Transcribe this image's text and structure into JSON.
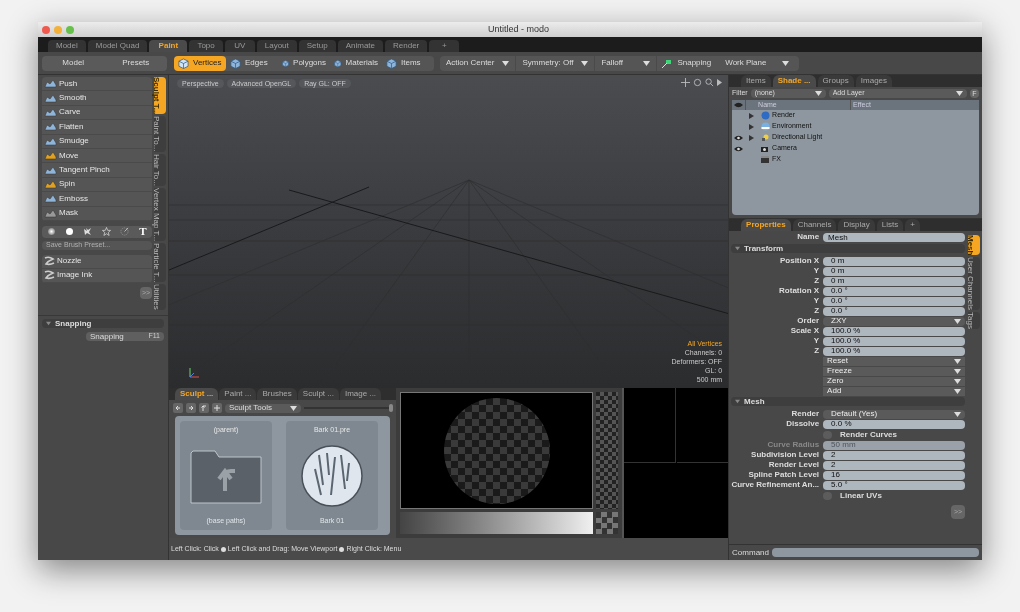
{
  "window": {
    "title": "Untitled - modo"
  },
  "layout_tabs": [
    {
      "label": "Model",
      "selected": false
    },
    {
      "label": "Model Quad",
      "selected": false
    },
    {
      "label": "Paint",
      "selected": true
    },
    {
      "label": "Topo",
      "selected": false
    },
    {
      "label": "UV",
      "selected": false
    },
    {
      "label": "Layout",
      "selected": false
    },
    {
      "label": "Setup",
      "selected": false
    },
    {
      "label": "Animate",
      "selected": false
    },
    {
      "label": "Render",
      "selected": false
    },
    {
      "label": "+",
      "selected": false
    }
  ],
  "toolbar": {
    "left_buttons": [
      "Model",
      "Presets"
    ],
    "selection_modes": [
      {
        "label": "Vertices",
        "selected": true
      },
      {
        "label": "Edges",
        "selected": false
      },
      {
        "label": "Polygons",
        "selected": false
      },
      {
        "label": "Materials",
        "selected": false
      },
      {
        "label": "Items",
        "selected": false
      }
    ],
    "dropdowns": [
      "Action Center",
      "Symmetry: Off",
      "Falloff"
    ],
    "snapping": "Snapping",
    "work_plane": "Work Plane"
  },
  "tools": [
    {
      "label": "Push"
    },
    {
      "label": "Smooth"
    },
    {
      "label": "Carve"
    },
    {
      "label": "Flatten"
    },
    {
      "label": "Smudge"
    },
    {
      "label": "Move"
    },
    {
      "label": "Tangent Pinch"
    },
    {
      "label": "Spin"
    },
    {
      "label": "Emboss"
    },
    {
      "label": "Mask"
    }
  ],
  "brush_shapes": [
    {
      "kind": "soft"
    },
    {
      "kind": "hard"
    },
    {
      "kind": "splat"
    },
    {
      "kind": "star"
    },
    {
      "kind": "angle"
    },
    {
      "kind": "text",
      "glyph": "T"
    }
  ],
  "save_preset_placeholder": "Save Brush Preset...",
  "inks": [
    {
      "label": "Nozzle"
    },
    {
      "label": "Image Ink"
    }
  ],
  "more_button": ">>",
  "side_tabs": [
    {
      "label": "Sculpt T...",
      "selected": true
    },
    {
      "label": "Paint To...",
      "selected": false
    },
    {
      "label": "Hair To...",
      "selected": false
    },
    {
      "label": "Vertex Map T...",
      "selected": false
    },
    {
      "label": "Particle T...",
      "selected": false
    },
    {
      "label": "Utilities",
      "selected": false
    }
  ],
  "snapping_section": {
    "title": "Snapping",
    "expanded": true,
    "item": "Snapping",
    "shortcut": "F11"
  },
  "viewport": {
    "buttons": [
      "Perspective",
      "Advanced OpenGL",
      "Ray GL: OFF"
    ],
    "info": [
      {
        "text": "All Vertices",
        "highlight": true
      },
      {
        "text": "Channels: 0",
        "highlight": false
      },
      {
        "text": "Deformers: OFF",
        "highlight": false
      },
      {
        "text": "GL: 0",
        "highlight": false
      },
      {
        "text": "500 mm",
        "highlight": false
      }
    ]
  },
  "preset_browser": {
    "tabs": [
      {
        "label": "Sculpt ...",
        "selected": true
      },
      {
        "label": "Paint ...",
        "selected": false
      },
      {
        "label": "Brushes",
        "selected": false
      },
      {
        "label": "Sculpt ...",
        "selected": false
      },
      {
        "label": "Image ...",
        "selected": false
      }
    ],
    "dropdown": "Sculpt Tools",
    "slider": {
      "level": 0.97
    },
    "items": [
      {
        "kind": "folder",
        "title": "(parent)",
        "caption": "(base paths)"
      },
      {
        "kind": "sphere",
        "title": "Bark 01.pre",
        "caption": "Bark 01"
      }
    ]
  },
  "status_bar": [
    "Left Click: Click",
    "Left Click and Drag: Move Viewport",
    "Right Click: Menu"
  ],
  "shader_tree": {
    "tabs": [
      {
        "label": "Items",
        "selected": false
      },
      {
        "label": "Shade ...",
        "selected": true
      },
      {
        "label": "Groups",
        "selected": false
      },
      {
        "label": "Images",
        "selected": false
      }
    ],
    "filter_label": "Filter",
    "filter_value": "(none)",
    "add_layer": "Add Layer",
    "f_button": "F",
    "columns": [
      "Name",
      "Effect"
    ],
    "rows": [
      {
        "name": "Render",
        "kind": "render",
        "visible": false,
        "expandable": true
      },
      {
        "name": "Environment",
        "kind": "environment",
        "visible": false,
        "expandable": true
      },
      {
        "name": "Directional Light",
        "kind": "light",
        "visible": true,
        "expandable": true
      },
      {
        "name": "Camera",
        "kind": "camera",
        "visible": true,
        "expandable": false
      },
      {
        "name": "FX",
        "kind": "fx",
        "visible": false,
        "expandable": false
      }
    ]
  },
  "properties": {
    "tabs": [
      {
        "label": "Properties",
        "selected": true
      },
      {
        "label": "Channels",
        "selected": false
      },
      {
        "label": "Display",
        "selected": false
      },
      {
        "label": "Lists",
        "selected": false
      },
      {
        "label": "+",
        "selected": false
      }
    ],
    "name_label": "Name",
    "name_value": "Mesh",
    "side_tabs": [
      {
        "label": "Mesh",
        "selected": true
      },
      {
        "label": "User Channels",
        "selected": false
      },
      {
        "label": "Tags",
        "selected": false
      }
    ],
    "sections": [
      {
        "title": "Transform",
        "expanded": true,
        "rows": [
          {
            "kind": "value",
            "label": "Position X",
            "value": "0 m"
          },
          {
            "kind": "value",
            "label": "Y",
            "value": "0 m"
          },
          {
            "kind": "value",
            "label": "Z",
            "value": "0 m"
          },
          {
            "kind": "value",
            "label": "Rotation X",
            "value": "0.0 °"
          },
          {
            "kind": "value",
            "label": "Y",
            "value": "0.0 °"
          },
          {
            "kind": "value",
            "label": "Z",
            "value": "0.0 °"
          },
          {
            "kind": "dropdown",
            "label": "Order",
            "value": "ZXY"
          },
          {
            "kind": "value",
            "label": "Scale X",
            "value": "100.0 %"
          },
          {
            "kind": "value",
            "label": "Y",
            "value": "100.0 %"
          },
          {
            "kind": "value",
            "label": "Z",
            "value": "100.0 %"
          },
          {
            "kind": "menu",
            "value": "Reset"
          },
          {
            "kind": "menu",
            "value": "Freeze"
          },
          {
            "kind": "menu",
            "value": "Zero"
          },
          {
            "kind": "menu",
            "value": "Add"
          }
        ]
      },
      {
        "title": "Mesh",
        "expanded": true,
        "rows": [
          {
            "kind": "dropdown",
            "label": "Render",
            "value": "Default (Yes)"
          },
          {
            "kind": "value",
            "label": "Dissolve",
            "value": "0.0 %"
          },
          {
            "kind": "checkbox",
            "value": "Render Curves",
            "checked": false
          },
          {
            "kind": "value",
            "label": "Curve Radius",
            "value": "50 mm",
            "disabled": true
          },
          {
            "kind": "value",
            "label": "Subdivision Level",
            "value": "2"
          },
          {
            "kind": "value",
            "label": "Render Level",
            "value": "2"
          },
          {
            "kind": "value",
            "label": "Spline Patch Level",
            "value": "16"
          },
          {
            "kind": "value",
            "label": "Curve Refinement An...",
            "value": "5.0 °"
          },
          {
            "kind": "checkbox",
            "value": "Linear UVs",
            "checked": false
          }
        ]
      }
    ],
    "more_button": ">>"
  },
  "command": {
    "label": "Command"
  }
}
